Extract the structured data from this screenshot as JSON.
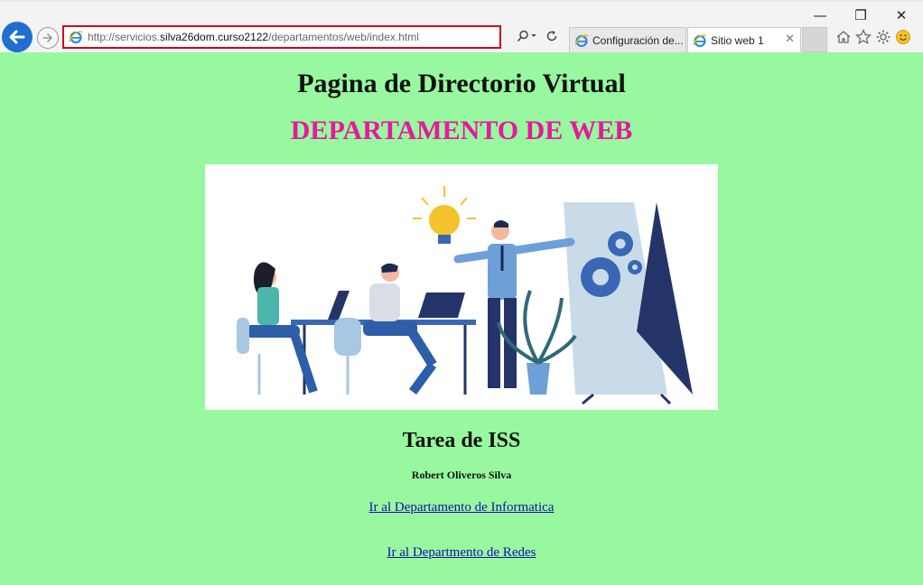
{
  "browser": {
    "url_prefix": "http://servicios.",
    "url_host": "silva26dom.curso2122",
    "url_path": "/departamentos/web/index.html",
    "tabs": [
      {
        "label": "Configuración de...",
        "active": false
      },
      {
        "label": "Sitio web 1",
        "active": true
      }
    ],
    "window_controls": {
      "minimize": "—",
      "restore": "❐",
      "close": "✕"
    },
    "tab_close": "✕"
  },
  "page": {
    "title": "Pagina de Directorio Virtual",
    "department": "DEPARTAMENTO DE WEB",
    "task": "Tarea de ISS",
    "author": "Robert Oliveros Silva",
    "links": [
      {
        "label": "Ir al Departamento de Informatica"
      },
      {
        "label": "Ir al Departmento de Redes"
      }
    ]
  },
  "colors": {
    "page_background": "#98f89f",
    "department_heading": "#e8179f",
    "link": "#1a0dab",
    "address_highlight": "#d0021b",
    "back_button": "#1f6fd1"
  },
  "icons": [
    "back-arrow-icon",
    "forward-arrow-icon",
    "ie-logo-icon",
    "search-icon",
    "refresh-icon",
    "home-icon",
    "favorites-star-icon",
    "settings-gear-icon",
    "smiley-feedback-icon"
  ]
}
